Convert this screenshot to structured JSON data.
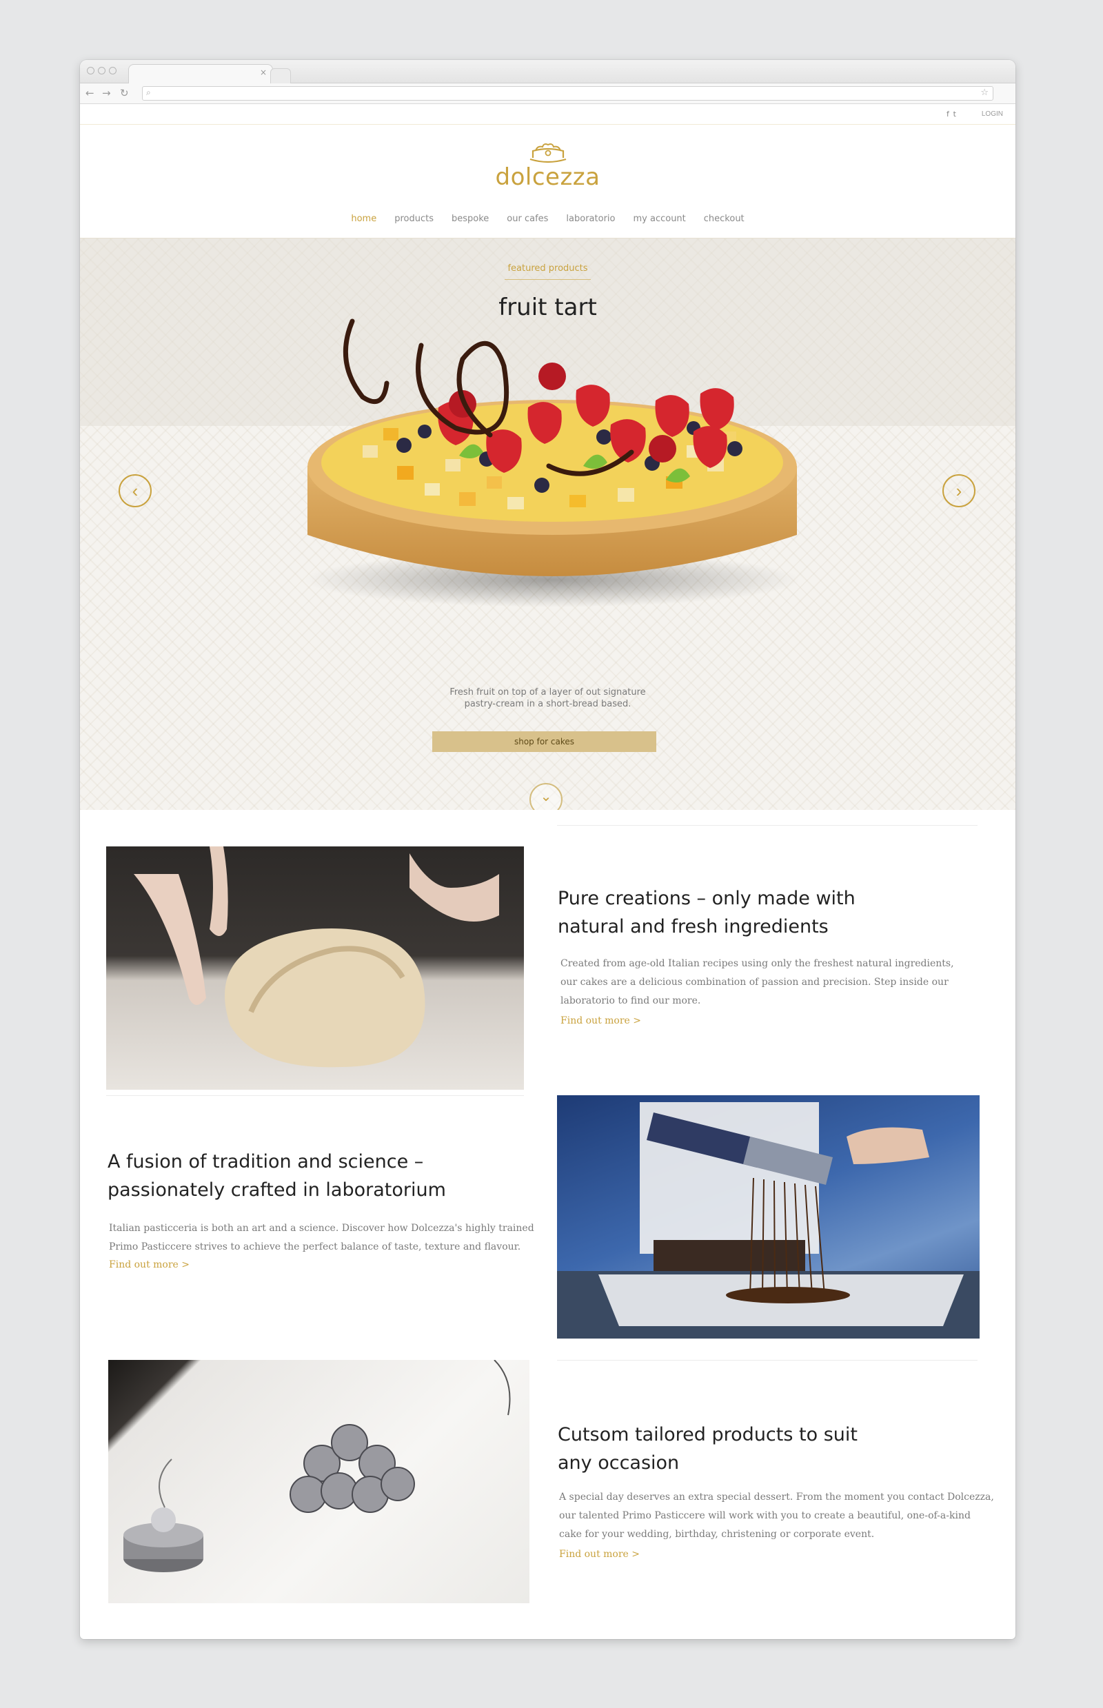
{
  "site": {
    "logo_text": "dolcezza",
    "login": "LOGIN",
    "social_icons": [
      "facebook-icon",
      "twitter-icon"
    ],
    "brand_color": "#c9a23e"
  },
  "nav": {
    "items": [
      "home",
      "products",
      "bespoke",
      "our cafes",
      "laboratorio",
      "my account",
      "checkout"
    ],
    "active": "home"
  },
  "hero": {
    "eyebrow": "featured products",
    "title": "fruit tart",
    "description_line1": "Fresh fruit on top of a layer of out signature",
    "description_line2": "pastry-cream in a short-bread based.",
    "cta": "shop for cakes",
    "prev_icon": "chevron-left-icon",
    "next_icon": "chevron-right-icon",
    "scroll_icon": "chevron-down-icon"
  },
  "sections": [
    {
      "title_line1": "Pure creations – only made with",
      "title_line2": "natural and fresh ingredients",
      "body_line1": "Created from age-old Italian recipes using only the freshest natural ingredients,",
      "body_line2": "our cakes are a delicious combination of passion and precision. Step inside our",
      "body_line3": "laboratorio to find our more.",
      "link": "Find out more >"
    },
    {
      "title_line1": "A fusion of tradition and science –",
      "title_line2": "passionately crafted in laboratorium",
      "body_line1": "Italian pasticceria is both an art and a science. Discover how Dolcezza's highly trained",
      "body_line2": "Primo Pasticcere strives to achieve the perfect balance of taste, texture and flavour.",
      "link": "Find out more >"
    },
    {
      "title_line1": "Cutsom tailored products to suit",
      "title_line2": "any occasion",
      "body_line1": "A special day deserves an extra special dessert. From the moment you contact Dolcezza,",
      "body_line2": "our talented Primo Pasticcere will work with you to create a beautiful, one-of-a-kind",
      "body_line3": "cake for your wedding, birthday, christening or corporate event.",
      "link": "Find out more >"
    }
  ]
}
